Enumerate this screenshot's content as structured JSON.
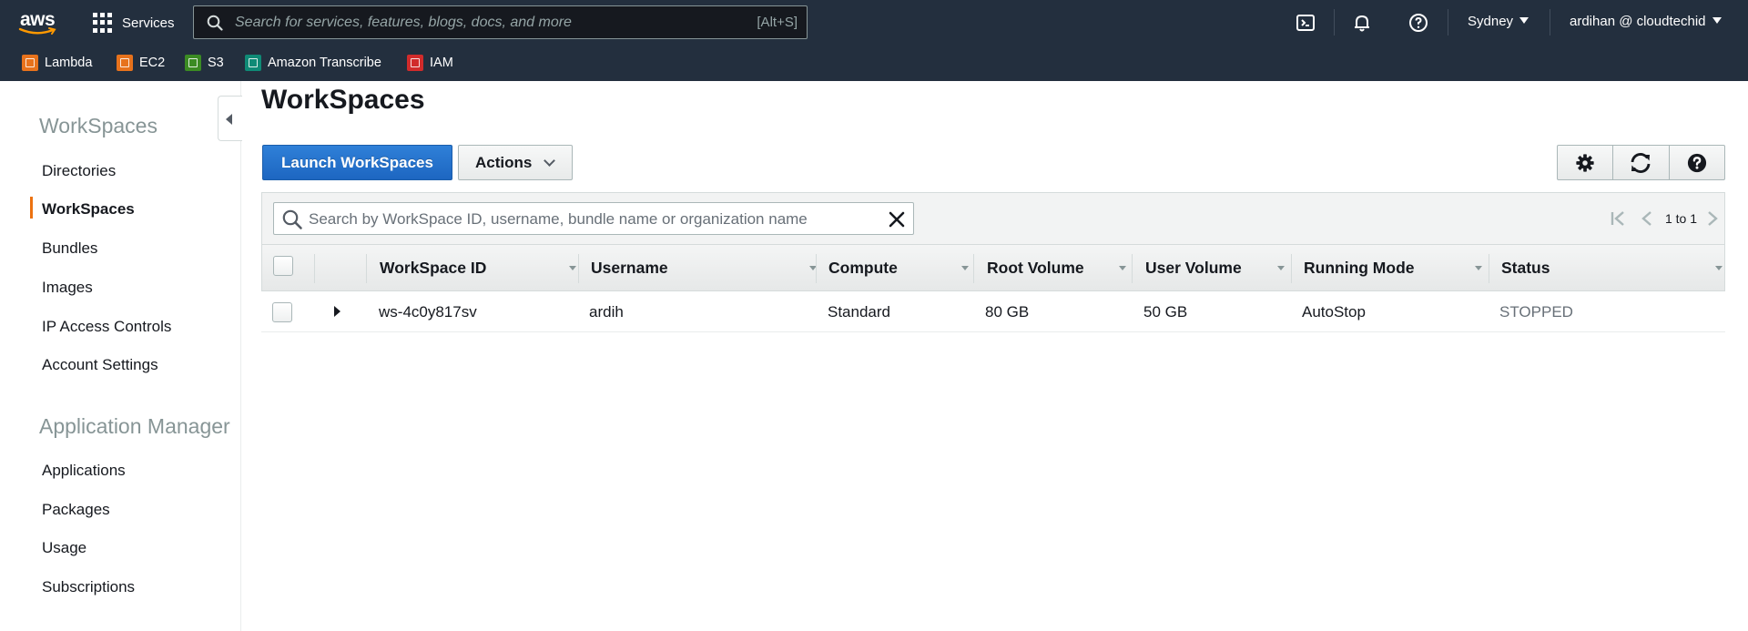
{
  "topnav": {
    "logo_text": "aws",
    "services_label": "Services",
    "search_placeholder": "Search for services, features, blogs, docs, and more",
    "search_shortcut": "[Alt+S]",
    "region": "Sydney",
    "user": "ardihan @ cloudtechid"
  },
  "favorites": [
    {
      "label": "Lambda",
      "color": "#e7721c"
    },
    {
      "label": "EC2",
      "color": "#e7721c"
    },
    {
      "label": "S3",
      "color": "#3b8b23"
    },
    {
      "label": "Amazon Transcribe",
      "color": "#0f8a76"
    },
    {
      "label": "IAM",
      "color": "#d12b2b"
    }
  ],
  "sidebar": {
    "section1_title": "WorkSpaces",
    "section1_items": [
      "Directories",
      "WorkSpaces",
      "Bundles",
      "Images",
      "IP Access Controls",
      "Account Settings"
    ],
    "section2_title": "Application Manager",
    "section2_items": [
      "Applications",
      "Packages",
      "Usage",
      "Subscriptions"
    ]
  },
  "main": {
    "title": "WorkSpaces",
    "launch_label": "Launch WorkSpaces",
    "actions_label": "Actions",
    "filter_placeholder": "Search by WorkSpace ID, username, bundle name or organization name",
    "pager_text": "1 to 1"
  },
  "table": {
    "columns": [
      "WorkSpace ID",
      "Username",
      "Compute",
      "Root Volume",
      "User Volume",
      "Running Mode",
      "Status"
    ],
    "rows": [
      {
        "id": "ws-4c0y817sv",
        "username": "ardih",
        "compute": "Standard",
        "root_volume": "80 GB",
        "user_volume": "50 GB",
        "running_mode": "AutoStop",
        "status": "STOPPED"
      }
    ]
  },
  "colors": {
    "nav_bg": "#232f3e",
    "primary_button": "#1d66c1",
    "active_indicator": "#ec7211"
  }
}
